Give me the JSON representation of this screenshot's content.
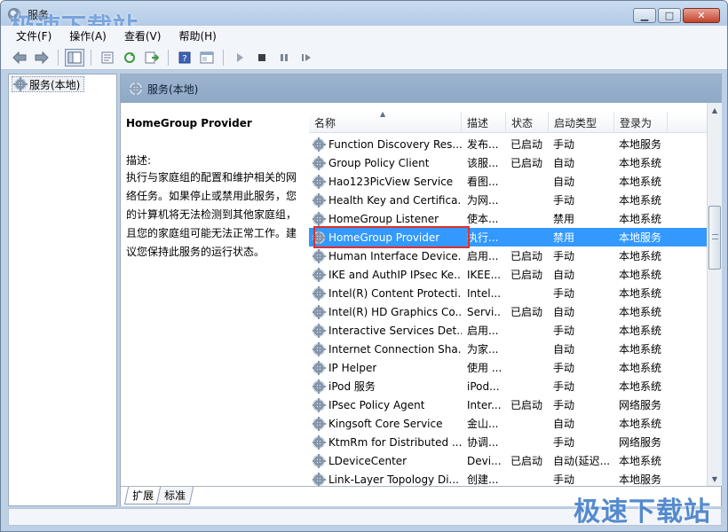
{
  "window": {
    "title": "服务",
    "watermark": "极速下载站",
    "controls": [
      "minimize",
      "maximize",
      "close"
    ]
  },
  "menu": [
    "文件(F)",
    "操作(A)",
    "查看(V)",
    "帮助(H)"
  ],
  "toolbar_icons": [
    "back-arrow-icon",
    "forward-arrow-icon",
    "show-hide-tree-icon",
    "properties-icon",
    "refresh-icon",
    "export-list-icon",
    "help-icon",
    "console-icon",
    "play-icon",
    "stop-icon",
    "pause-icon",
    "restart-icon"
  ],
  "tree": {
    "selected_label": "服务(本地)"
  },
  "main": {
    "header": "服务(本地)",
    "detail": {
      "title": "HomeGroup Provider",
      "label": "描述:",
      "description": "执行与家庭组的配置和维护相关的网络任务。如果停止或禁用此服务，您的计算机将无法检测到其他家庭组，且您的家庭组可能无法正常工作。建议您保持此服务的运行状态。"
    },
    "columns": [
      "名称",
      "描述",
      "状态",
      "启动类型",
      "登录为"
    ],
    "rows": [
      {
        "name": "Function Discovery Res...",
        "desc": "发布...",
        "status": "已启动",
        "startup": "手动",
        "logon": "本地服务"
      },
      {
        "name": "Group Policy Client",
        "desc": "该服...",
        "status": "已启动",
        "startup": "自动",
        "logon": "本地系统"
      },
      {
        "name": "Hao123PicView Service",
        "desc": "看图...",
        "status": "",
        "startup": "自动",
        "logon": "本地系统"
      },
      {
        "name": "Health Key and Certifica...",
        "desc": "为网...",
        "status": "",
        "startup": "手动",
        "logon": "本地系统"
      },
      {
        "name": "HomeGroup Listener",
        "desc": "使本...",
        "status": "",
        "startup": "禁用",
        "logon": "本地系统"
      },
      {
        "name": "HomeGroup Provider",
        "desc": "执行...",
        "status": "",
        "startup": "禁用",
        "logon": "本地服务",
        "selected": true
      },
      {
        "name": "Human Interface Device...",
        "desc": "启用...",
        "status": "已启动",
        "startup": "手动",
        "logon": "本地系统"
      },
      {
        "name": "IKE and AuthIP IPsec Ke...",
        "desc": "IKEE...",
        "status": "已启动",
        "startup": "自动",
        "logon": "本地系统"
      },
      {
        "name": "Intel(R) Content Protecti...",
        "desc": "Intel...",
        "status": "",
        "startup": "手动",
        "logon": "本地系统"
      },
      {
        "name": "Intel(R) HD Graphics Co...",
        "desc": "Servi...",
        "status": "已启动",
        "startup": "自动",
        "logon": "本地系统"
      },
      {
        "name": "Interactive Services Det...",
        "desc": "启用...",
        "status": "",
        "startup": "手动",
        "logon": "本地系统"
      },
      {
        "name": "Internet Connection Sha...",
        "desc": "为家...",
        "status": "",
        "startup": "自动",
        "logon": "本地系统"
      },
      {
        "name": "IP Helper",
        "desc": "使用 ...",
        "status": "",
        "startup": "手动",
        "logon": "本地系统"
      },
      {
        "name": "iPod 服务",
        "desc": "iPod...",
        "status": "",
        "startup": "手动",
        "logon": "本地系统"
      },
      {
        "name": "IPsec Policy Agent",
        "desc": "Inter...",
        "status": "已启动",
        "startup": "手动",
        "logon": "网络服务"
      },
      {
        "name": "Kingsoft Core Service",
        "desc": "金山...",
        "status": "",
        "startup": "自动",
        "logon": "本地系统"
      },
      {
        "name": "KtmRm for Distributed ...",
        "desc": "协调...",
        "status": "",
        "startup": "手动",
        "logon": "网络服务"
      },
      {
        "name": "LDeviceCenter",
        "desc": "Devi...",
        "status": "已启动",
        "startup": "自动(延迟...",
        "logon": "本地系统"
      },
      {
        "name": "Link-Layer Topology Di...",
        "desc": "创建...",
        "status": "",
        "startup": "手动",
        "logon": "本地服务"
      }
    ],
    "tabs": [
      "扩展",
      "标准"
    ],
    "active_tab": "扩展"
  }
}
